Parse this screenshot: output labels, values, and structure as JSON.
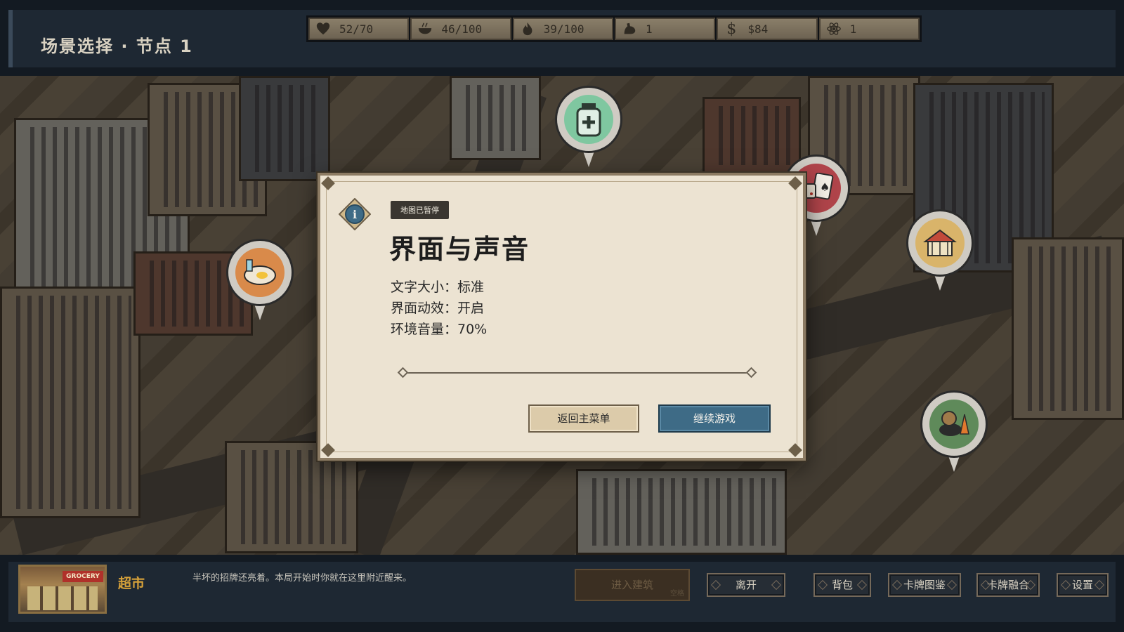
{
  "header": {
    "scene_title": "场景选择 · 节点 1",
    "stats": [
      {
        "icon": "heart-icon",
        "value": "52/70"
      },
      {
        "icon": "food-bowl-icon",
        "value": "46/100"
      },
      {
        "icon": "fire-icon",
        "value": "39/100"
      },
      {
        "icon": "strength-arm-icon",
        "value": "1"
      },
      {
        "icon": "dollar-icon",
        "value": "$84"
      },
      {
        "icon": "atom-icon",
        "value": "1"
      }
    ]
  },
  "map": {
    "locations": [
      {
        "name": "pharmacy",
        "icon": "medicine-bottle-icon",
        "color": "#7fc7a0"
      },
      {
        "name": "diner",
        "icon": "food-plate-icon",
        "color": "#d98a4a"
      },
      {
        "name": "casino",
        "icon": "dice-cards-icon",
        "color": "#b0444a"
      },
      {
        "name": "market",
        "icon": "market-tent-icon",
        "color": "#d9b46a"
      },
      {
        "name": "sewer",
        "icon": "manhole-cone-icon",
        "color": "#5f8a5a"
      }
    ]
  },
  "modal": {
    "paused_tag": "地图已暂停",
    "title": "界面与声音",
    "settings": [
      {
        "label": "文字大小：标准"
      },
      {
        "label": "界面动效：开启"
      },
      {
        "label": "环境音量：70%"
      }
    ],
    "main_menu_label": "返回主菜单",
    "continue_label": "继续游戏"
  },
  "bottom": {
    "thumb_sign": "GROCERY",
    "location_name": "超市",
    "description": "半坏的招牌还亮着。本局开始时你就在这里附近醒来。",
    "enter_label": "进入建筑",
    "enter_hint": "空格",
    "buttons": {
      "leave": "离开",
      "bag": "背包",
      "card_codex": "卡牌图鉴",
      "card_fusion": "卡牌融合",
      "settings": "设置"
    }
  },
  "colors": {
    "accent_blue": "#3e6b86",
    "location_gold": "#d7a23a",
    "panel_bg": "#1e2833"
  }
}
